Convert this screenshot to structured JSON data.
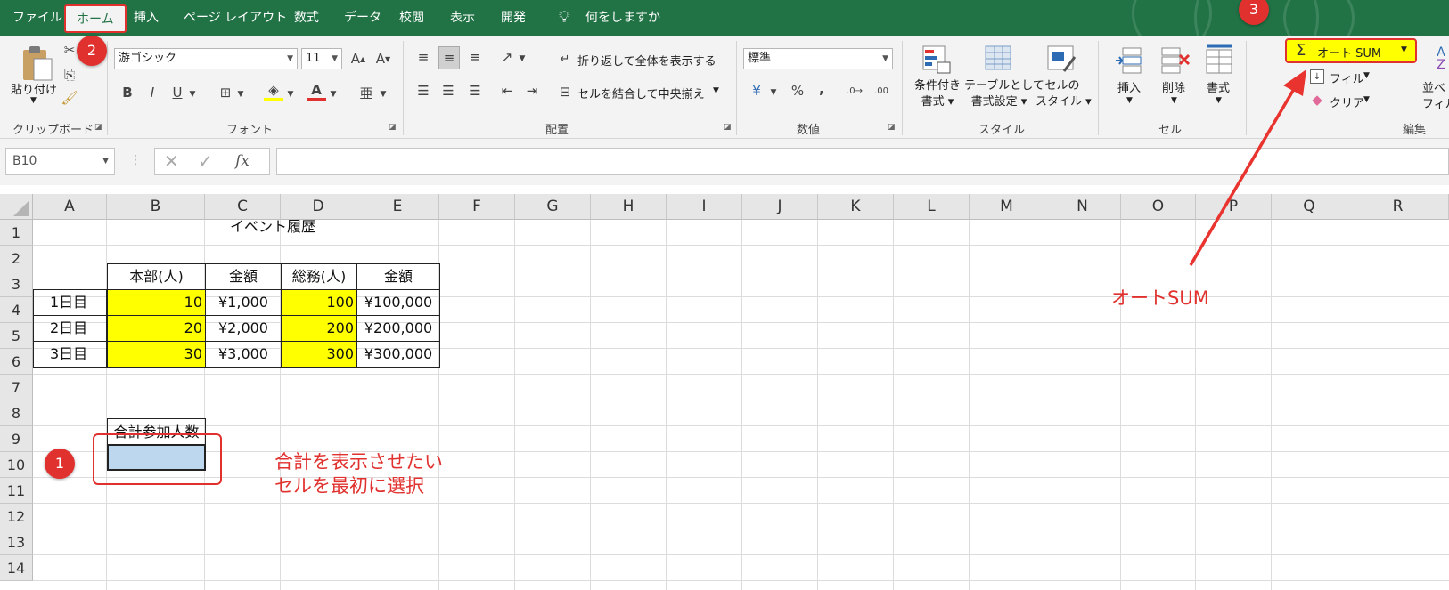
{
  "menu": {
    "tabs": [
      "ファイル",
      "ホーム",
      "挿入",
      "ページ レイアウト",
      "数式",
      "データ",
      "校閲",
      "表示",
      "開発"
    ],
    "tell_me": "何をしますか"
  },
  "ribbon": {
    "clipboard": {
      "paste": "貼り付け",
      "label": "クリップボード"
    },
    "font": {
      "name": "游ゴシック",
      "size": "11",
      "label": "フォント",
      "bold": "B",
      "italic": "I",
      "underline": "U"
    },
    "alignment": {
      "wrap": "折り返して全体を表示する",
      "merge": "セルを結合して中央揃え",
      "label": "配置"
    },
    "number": {
      "format": "標準",
      "label": "数値",
      "percent": "%",
      "comma": ","
    },
    "styles": {
      "conditional": [
        "条件付き",
        "書式"
      ],
      "table": [
        "テーブルとして",
        "書式設定"
      ],
      "cell": [
        "セルの",
        "スタイル"
      ],
      "label": "スタイル"
    },
    "cells": {
      "insert": "挿入",
      "delete": "削除",
      "format": "書式",
      "label": "セル"
    },
    "editing": {
      "autosum": "オート SUM",
      "fill": "フィル",
      "clear": "クリア",
      "sort1": "並べ",
      "sort2": "フィル",
      "label": "編集"
    }
  },
  "formula_bar": {
    "name_box": "B10",
    "fx": "fx"
  },
  "sheet": {
    "columns": [
      "A",
      "B",
      "C",
      "D",
      "E",
      "F",
      "G",
      "H",
      "I",
      "J",
      "K",
      "L",
      "M",
      "N",
      "O",
      "P",
      "Q",
      "R"
    ],
    "rows": [
      "1",
      "2",
      "3",
      "4",
      "5",
      "6",
      "7",
      "8",
      "9",
      "10",
      "11",
      "12",
      "13",
      "14"
    ],
    "title": "イベント履歴",
    "headers": [
      "本部(人)",
      "金額",
      "総務(人)",
      "金額"
    ],
    "data": [
      [
        "1日目",
        "10",
        "¥1,000",
        "100",
        "¥100,000"
      ],
      [
        "2日目",
        "20",
        "¥2,000",
        "200",
        "¥200,000"
      ],
      [
        "3日目",
        "30",
        "¥3,000",
        "300",
        "¥300,000"
      ]
    ],
    "sum_label": "合計参加人数"
  },
  "annotations": {
    "badge1": "1",
    "badge2": "2",
    "badge3": "3",
    "note1_line1": "合計を表示させたい",
    "note1_line2": "セルを最初に選択",
    "note3": "オートSUM"
  },
  "colors": {
    "excel_green": "#217346",
    "highlight_yellow": "#ffff00",
    "annotation_red": "#e0312e",
    "selected_cell": "#bdd7ee"
  }
}
